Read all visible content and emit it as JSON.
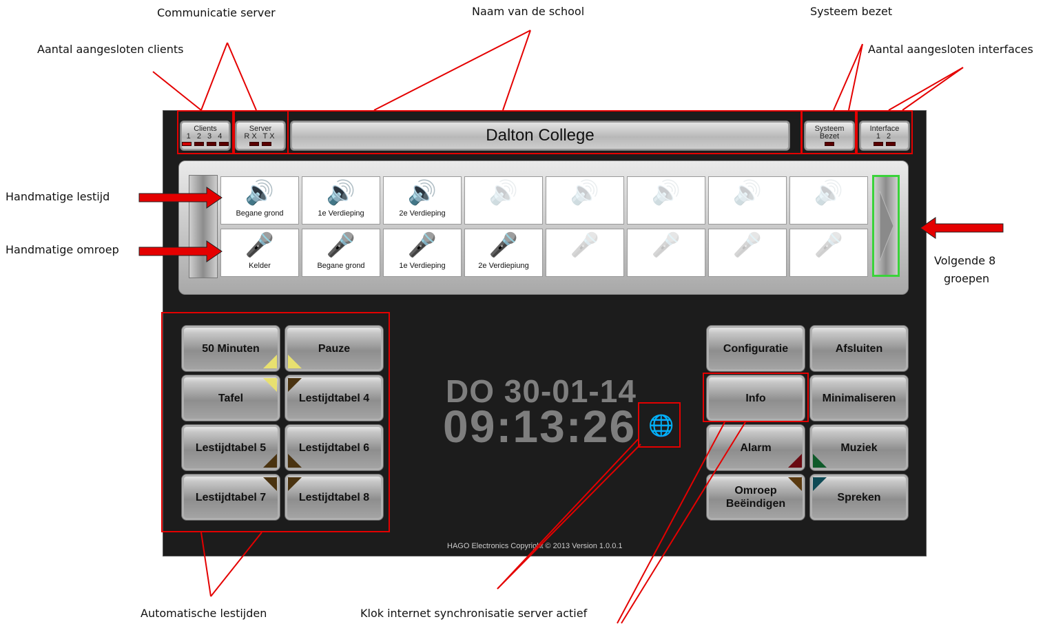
{
  "annotations": {
    "communicatie_server": "Communicatie server",
    "naam_school": "Naam van de school",
    "systeem_bezet": "Systeem bezet",
    "aantal_clients": "Aantal aangesloten clients",
    "aantal_interfaces": "Aantal aangesloten interfaces",
    "handmatige_lestijd": "Handmatige lestijd",
    "handmatige_omroep": "Handmatige omroep",
    "volgende_8_line1": "Volgende 8",
    "volgende_8_line2": "groepen",
    "automatische_lestijden": "Automatische lestijden",
    "klok_sync": "Klok internet synchronisatie server actief"
  },
  "topbar": {
    "clients": {
      "title": "Clients",
      "numbers": "1 2 3 4"
    },
    "server": {
      "title": "Server",
      "rx": "RX",
      "tx": "TX"
    },
    "school_name": "Dalton College",
    "systeem": {
      "line1": "Systeem",
      "line2": "Bezet"
    },
    "interface": {
      "title": "Interface",
      "numbers": "1 2"
    }
  },
  "groups": {
    "lestijd": [
      "Begane grond",
      "1e Verdieping",
      "2e Verdieping",
      "",
      "",
      "",
      "",
      ""
    ],
    "omroep": [
      "Kelder",
      "Begane grond",
      "1e Verdieping",
      "2e Verdiepiung",
      "",
      "",
      "",
      ""
    ]
  },
  "left_buttons": {
    "b1": "50 Minuten",
    "b2": "Pauze",
    "b3": "Tafel",
    "b4": "Lestijdtabel 4",
    "b5": "Lestijdtabel 5",
    "b6": "Lestijdtabel 6",
    "b7": "Lestijdtabel 7",
    "b8": "Lestijdtabel 8"
  },
  "right_buttons": {
    "configuratie": "Configuratie",
    "afsluiten": "Afsluiten",
    "info": "Info",
    "minimaliseren": "Minimaliseren",
    "alarm": "Alarm",
    "muziek": "Muziek",
    "omroep_l1": "Omroep",
    "omroep_l2": "Beëindigen",
    "spreken": "Spreken"
  },
  "clock": {
    "date": "DO 30-01-14",
    "time": "09:13:26"
  },
  "footer": "HAGO Electronics   Copyright © 2013   Version 1.0.0.1",
  "icons": {
    "speaker": "speaker-icon",
    "microphone": "microphone-icon",
    "globe_clock": "globe-clock-icon",
    "arrow": "arrow-icon"
  },
  "colors": {
    "annotation_red": "#e40000",
    "background_app": "#1c1c1c",
    "active_nav": "#3ad33a",
    "speaker_blue": "#2a56c6"
  }
}
